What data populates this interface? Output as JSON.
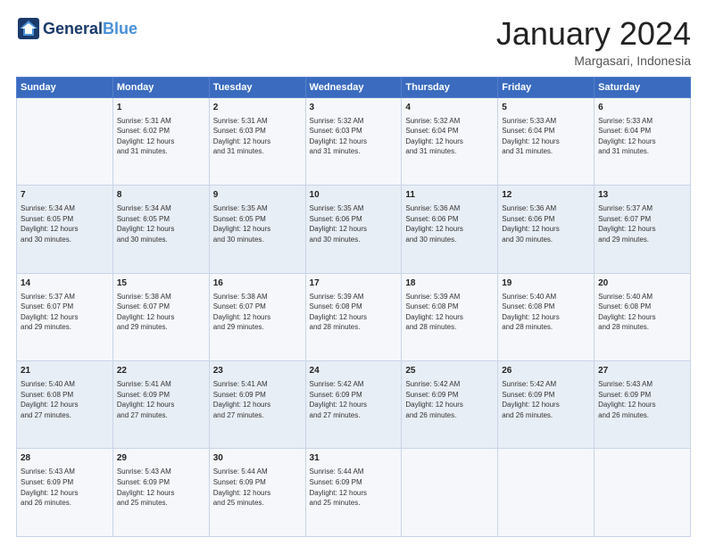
{
  "header": {
    "logo_main": "General",
    "logo_blue": "Blue",
    "title": "January 2024",
    "subtitle": "Margasari, Indonesia"
  },
  "days_of_week": [
    "Sunday",
    "Monday",
    "Tuesday",
    "Wednesday",
    "Thursday",
    "Friday",
    "Saturday"
  ],
  "weeks": [
    [
      {
        "num": "",
        "info": ""
      },
      {
        "num": "1",
        "info": "Sunrise: 5:31 AM\nSunset: 6:02 PM\nDaylight: 12 hours\nand 31 minutes."
      },
      {
        "num": "2",
        "info": "Sunrise: 5:31 AM\nSunset: 6:03 PM\nDaylight: 12 hours\nand 31 minutes."
      },
      {
        "num": "3",
        "info": "Sunrise: 5:32 AM\nSunset: 6:03 PM\nDaylight: 12 hours\nand 31 minutes."
      },
      {
        "num": "4",
        "info": "Sunrise: 5:32 AM\nSunset: 6:04 PM\nDaylight: 12 hours\nand 31 minutes."
      },
      {
        "num": "5",
        "info": "Sunrise: 5:33 AM\nSunset: 6:04 PM\nDaylight: 12 hours\nand 31 minutes."
      },
      {
        "num": "6",
        "info": "Sunrise: 5:33 AM\nSunset: 6:04 PM\nDaylight: 12 hours\nand 31 minutes."
      }
    ],
    [
      {
        "num": "7",
        "info": "Sunrise: 5:34 AM\nSunset: 6:05 PM\nDaylight: 12 hours\nand 30 minutes."
      },
      {
        "num": "8",
        "info": "Sunrise: 5:34 AM\nSunset: 6:05 PM\nDaylight: 12 hours\nand 30 minutes."
      },
      {
        "num": "9",
        "info": "Sunrise: 5:35 AM\nSunset: 6:05 PM\nDaylight: 12 hours\nand 30 minutes."
      },
      {
        "num": "10",
        "info": "Sunrise: 5:35 AM\nSunset: 6:06 PM\nDaylight: 12 hours\nand 30 minutes."
      },
      {
        "num": "11",
        "info": "Sunrise: 5:36 AM\nSunset: 6:06 PM\nDaylight: 12 hours\nand 30 minutes."
      },
      {
        "num": "12",
        "info": "Sunrise: 5:36 AM\nSunset: 6:06 PM\nDaylight: 12 hours\nand 30 minutes."
      },
      {
        "num": "13",
        "info": "Sunrise: 5:37 AM\nSunset: 6:07 PM\nDaylight: 12 hours\nand 29 minutes."
      }
    ],
    [
      {
        "num": "14",
        "info": "Sunrise: 5:37 AM\nSunset: 6:07 PM\nDaylight: 12 hours\nand 29 minutes."
      },
      {
        "num": "15",
        "info": "Sunrise: 5:38 AM\nSunset: 6:07 PM\nDaylight: 12 hours\nand 29 minutes."
      },
      {
        "num": "16",
        "info": "Sunrise: 5:38 AM\nSunset: 6:07 PM\nDaylight: 12 hours\nand 29 minutes."
      },
      {
        "num": "17",
        "info": "Sunrise: 5:39 AM\nSunset: 6:08 PM\nDaylight: 12 hours\nand 28 minutes."
      },
      {
        "num": "18",
        "info": "Sunrise: 5:39 AM\nSunset: 6:08 PM\nDaylight: 12 hours\nand 28 minutes."
      },
      {
        "num": "19",
        "info": "Sunrise: 5:40 AM\nSunset: 6:08 PM\nDaylight: 12 hours\nand 28 minutes."
      },
      {
        "num": "20",
        "info": "Sunrise: 5:40 AM\nSunset: 6:08 PM\nDaylight: 12 hours\nand 28 minutes."
      }
    ],
    [
      {
        "num": "21",
        "info": "Sunrise: 5:40 AM\nSunset: 6:08 PM\nDaylight: 12 hours\nand 27 minutes."
      },
      {
        "num": "22",
        "info": "Sunrise: 5:41 AM\nSunset: 6:09 PM\nDaylight: 12 hours\nand 27 minutes."
      },
      {
        "num": "23",
        "info": "Sunrise: 5:41 AM\nSunset: 6:09 PM\nDaylight: 12 hours\nand 27 minutes."
      },
      {
        "num": "24",
        "info": "Sunrise: 5:42 AM\nSunset: 6:09 PM\nDaylight: 12 hours\nand 27 minutes."
      },
      {
        "num": "25",
        "info": "Sunrise: 5:42 AM\nSunset: 6:09 PM\nDaylight: 12 hours\nand 26 minutes."
      },
      {
        "num": "26",
        "info": "Sunrise: 5:42 AM\nSunset: 6:09 PM\nDaylight: 12 hours\nand 26 minutes."
      },
      {
        "num": "27",
        "info": "Sunrise: 5:43 AM\nSunset: 6:09 PM\nDaylight: 12 hours\nand 26 minutes."
      }
    ],
    [
      {
        "num": "28",
        "info": "Sunrise: 5:43 AM\nSunset: 6:09 PM\nDaylight: 12 hours\nand 26 minutes."
      },
      {
        "num": "29",
        "info": "Sunrise: 5:43 AM\nSunset: 6:09 PM\nDaylight: 12 hours\nand 25 minutes."
      },
      {
        "num": "30",
        "info": "Sunrise: 5:44 AM\nSunset: 6:09 PM\nDaylight: 12 hours\nand 25 minutes."
      },
      {
        "num": "31",
        "info": "Sunrise: 5:44 AM\nSunset: 6:09 PM\nDaylight: 12 hours\nand 25 minutes."
      },
      {
        "num": "",
        "info": ""
      },
      {
        "num": "",
        "info": ""
      },
      {
        "num": "",
        "info": ""
      }
    ]
  ]
}
